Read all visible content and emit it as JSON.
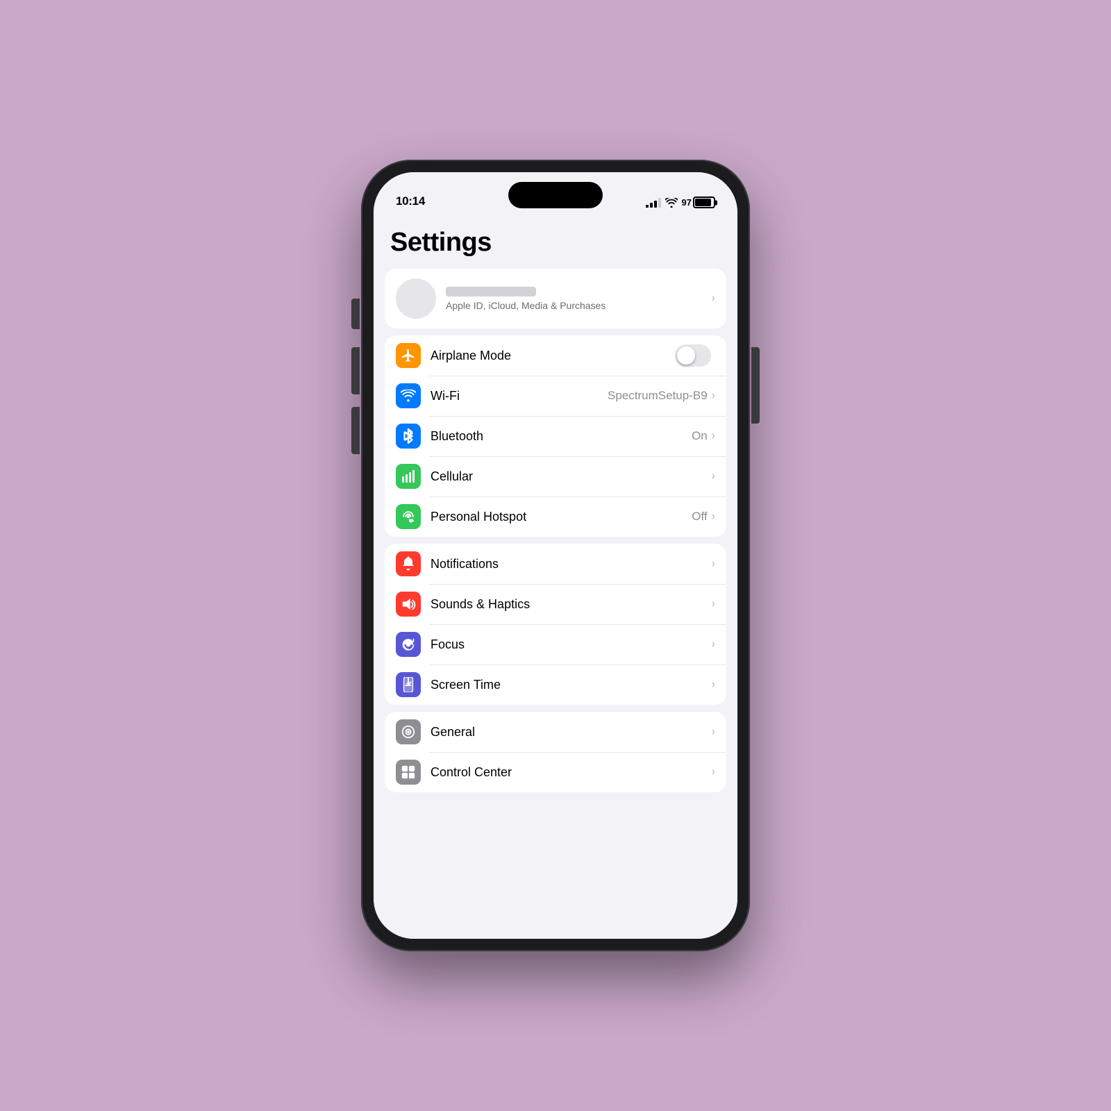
{
  "phone": {
    "status_bar": {
      "time": "10:14",
      "battery_percent": "97"
    },
    "title": "Settings",
    "apple_id": {
      "subtitle": "Apple ID, iCloud, Media & Purchases"
    },
    "groups": [
      {
        "id": "connectivity",
        "items": [
          {
            "id": "airplane-mode",
            "label": "Airplane Mode",
            "value": "",
            "has_toggle": true,
            "toggle_on": false,
            "icon_color": "orange",
            "icon_type": "airplane"
          },
          {
            "id": "wifi",
            "label": "Wi-Fi",
            "value": "SpectrumSetup-B9",
            "has_toggle": false,
            "icon_color": "blue",
            "icon_type": "wifi"
          },
          {
            "id": "bluetooth",
            "label": "Bluetooth",
            "value": "On",
            "has_toggle": false,
            "icon_color": "blue",
            "icon_type": "bluetooth"
          },
          {
            "id": "cellular",
            "label": "Cellular",
            "value": "",
            "has_toggle": false,
            "icon_color": "green",
            "icon_type": "cellular"
          },
          {
            "id": "hotspot",
            "label": "Personal Hotspot",
            "value": "Off",
            "has_toggle": false,
            "icon_color": "green",
            "icon_type": "hotspot"
          }
        ]
      },
      {
        "id": "notifications",
        "items": [
          {
            "id": "notifications",
            "label": "Notifications",
            "value": "",
            "has_toggle": false,
            "icon_color": "red",
            "icon_type": "bell"
          },
          {
            "id": "sounds",
            "label": "Sounds & Haptics",
            "value": "",
            "has_toggle": false,
            "icon_color": "red",
            "icon_type": "sound"
          },
          {
            "id": "focus",
            "label": "Focus",
            "value": "",
            "has_toggle": false,
            "icon_color": "purple",
            "icon_type": "moon"
          },
          {
            "id": "screentime",
            "label": "Screen Time",
            "value": "",
            "has_toggle": false,
            "icon_color": "purple",
            "icon_type": "hourglass"
          }
        ]
      },
      {
        "id": "system",
        "items": [
          {
            "id": "general",
            "label": "General",
            "value": "",
            "has_toggle": false,
            "icon_color": "gray",
            "icon_type": "gear"
          },
          {
            "id": "control-center",
            "label": "Control Center",
            "value": "",
            "has_toggle": false,
            "icon_color": "gray",
            "icon_type": "sliders"
          }
        ]
      }
    ]
  }
}
